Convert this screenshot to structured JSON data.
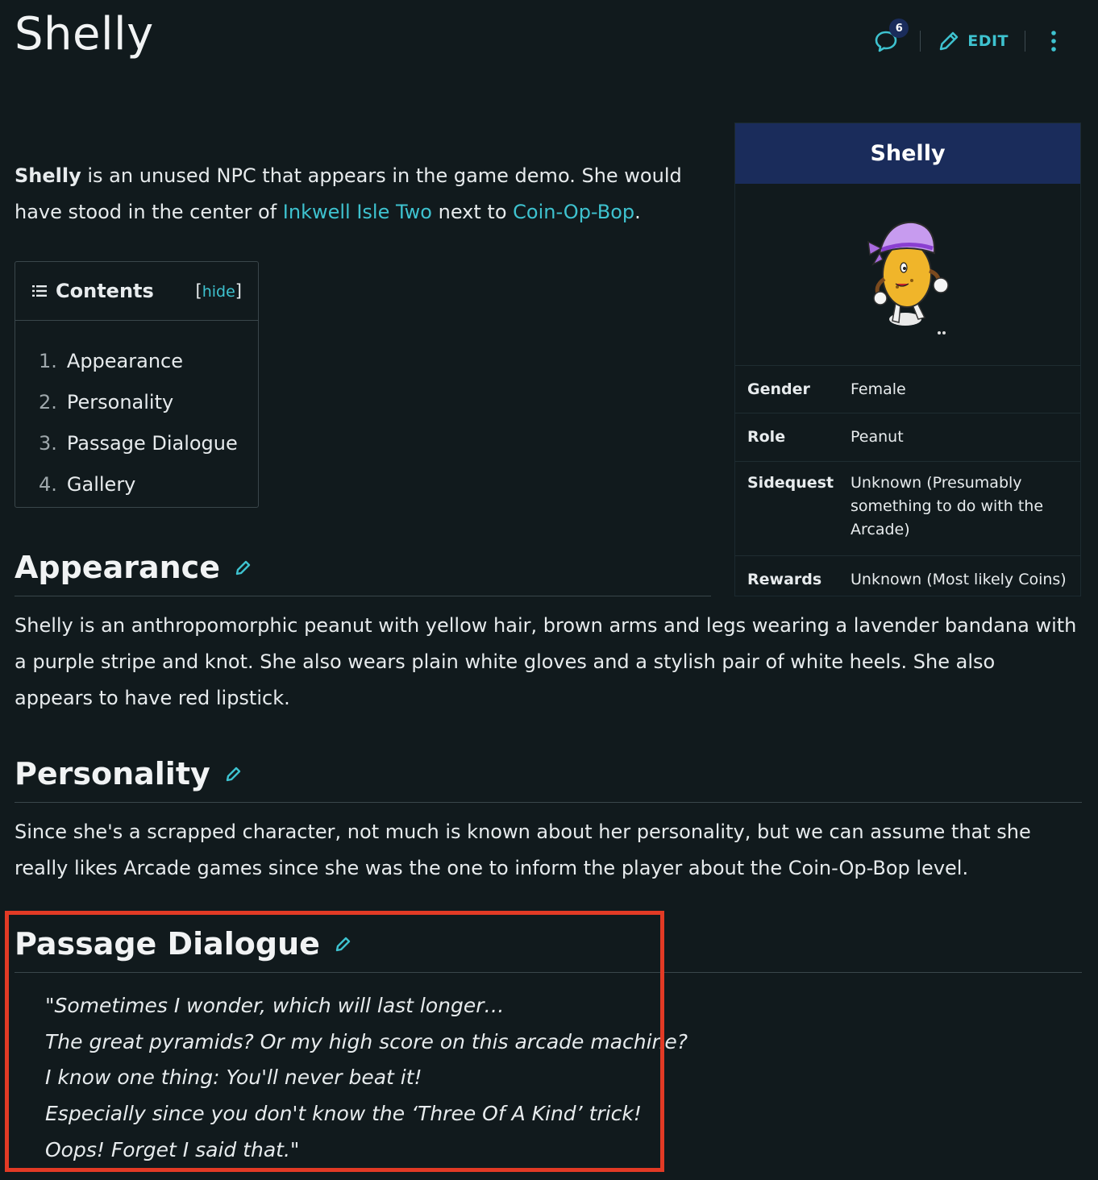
{
  "page": {
    "title": "Shelly"
  },
  "actions": {
    "comment_count": "6",
    "edit_label": "EDIT"
  },
  "intro": {
    "subject": "Shelly",
    "text1": " is an unused NPC that appears in the game demo. She would have stood in the center of ",
    "link1": "Inkwell Isle Two",
    "text2": " next to ",
    "link2": "Coin-Op-Bop",
    "text3": "."
  },
  "toc": {
    "title": "Contents",
    "toggle_open": "[",
    "toggle_link": "hide",
    "toggle_close": "]",
    "items": [
      {
        "num": "1.",
        "label": "Appearance"
      },
      {
        "num": "2.",
        "label": "Personality"
      },
      {
        "num": "3.",
        "label": "Passage Dialogue"
      },
      {
        "num": "4.",
        "label": "Gallery"
      }
    ]
  },
  "infobox": {
    "title": "Shelly",
    "rows": [
      {
        "label": "Gender",
        "value": "Female"
      },
      {
        "label": "Role",
        "value": "Peanut"
      },
      {
        "label": "Sidequest",
        "value": "Unknown (Presumably something to do with the Arcade)"
      },
      {
        "label": "Rewards",
        "value": "Unknown (Most likely Coins)"
      }
    ]
  },
  "sections": {
    "appearance": {
      "heading": "Appearance",
      "text": "Shelly is an anthropomorphic peanut with yellow hair, brown arms and legs wearing a lavender bandana with a purple stripe and knot. She also wears plain white gloves and a stylish pair of white heels. She also appears to have red lipstick."
    },
    "personality": {
      "heading": "Personality",
      "text": "Since she's a scrapped character, not much is known about her personality, but we can assume that she really likes Arcade games since she was the one to inform the player about the Coin-Op-Bop level."
    },
    "dialogue": {
      "heading": "Passage Dialogue",
      "lines": [
        "\"Sometimes I wonder, which will last longer…",
        "The great pyramids? Or my high score on this arcade machine?",
        "I know one thing: You'll never beat it!",
        "Especially since you don't know the ‘Three Of A Kind’ trick!",
        "Oops! Forget I said that.\""
      ]
    }
  },
  "colors": {
    "background": "#111a1d",
    "accent": "#3ec2cf",
    "infobox_header": "#1a2c5b",
    "highlight": "#e23a25"
  },
  "icons": {
    "comments": "comment-bubble-icon",
    "edit": "pencil-icon",
    "more": "vertical-dots-icon",
    "toc": "list-icon",
    "section_edit": "pencil-icon"
  }
}
